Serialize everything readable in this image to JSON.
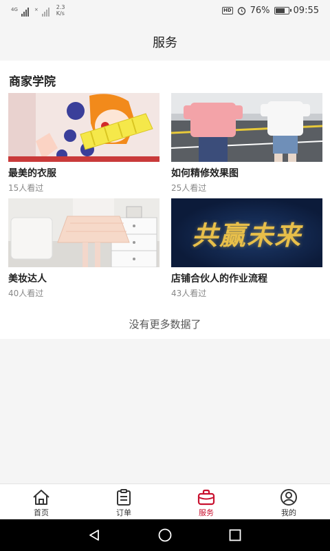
{
  "status_bar": {
    "network": "4G",
    "speed_value": "2.3",
    "speed_unit": "K/s",
    "hd": "HD",
    "battery": "76%",
    "battery_level": 0.76,
    "time": "09:55"
  },
  "header": {
    "title": "服务"
  },
  "section": {
    "title": "商家学院",
    "cards": [
      {
        "name": "最美的衣服",
        "views": "15人看过"
      },
      {
        "name": "如何精修效果图",
        "views": "25人看过"
      },
      {
        "name": "美妆达人",
        "views": "40人看过"
      },
      {
        "name": "店铺合伙人的作业流程",
        "views": "43人看过",
        "banner_text": "共赢未来"
      }
    ],
    "no_more": "没有更多数据了"
  },
  "tabbar": {
    "active": "service",
    "accent": "#c8102e",
    "items": [
      {
        "label": "首页",
        "icon": "home-icon"
      },
      {
        "label": "订单",
        "icon": "clipboard-icon"
      },
      {
        "label": "服务",
        "icon": "bag-icon"
      },
      {
        "label": "我的",
        "icon": "person-icon"
      }
    ]
  }
}
